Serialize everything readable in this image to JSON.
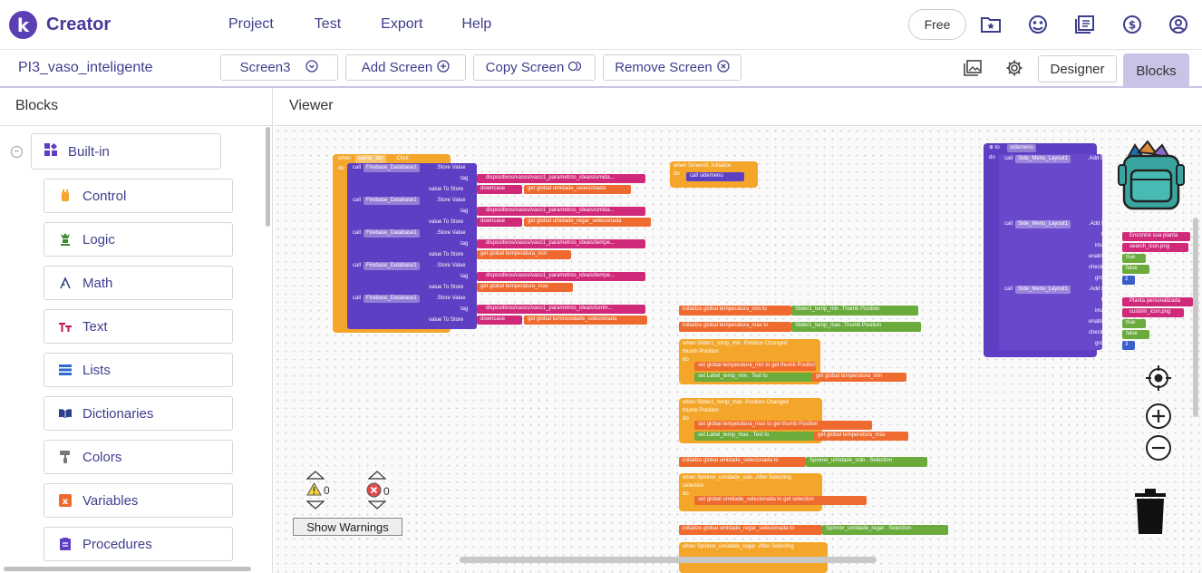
{
  "app": {
    "logo_letter": "k",
    "logo_text": "Creator"
  },
  "menu": [
    "Project",
    "Test",
    "Export",
    "Help"
  ],
  "top_right": {
    "free_label": "Free"
  },
  "toolbar": {
    "project_name": "PI3_vaso_inteligente",
    "screen_label": "Screen3",
    "add_screen": "Add Screen",
    "copy_screen": "Copy Screen",
    "remove_screen": "Remove Screen",
    "designer": "Designer",
    "blocks": "Blocks"
  },
  "left_panel": {
    "title": "Blocks",
    "builtin": "Built-in",
    "categories": [
      "Control",
      "Logic",
      "Math",
      "Text",
      "Lists",
      "Dictionaries",
      "Colors",
      "Variables",
      "Procedures"
    ]
  },
  "viewer": {
    "title": "Viewer",
    "warnings_count": "0",
    "errors_count": "0",
    "show_warnings": "Show Warnings"
  },
  "blocks": {
    "salvar_when": "when",
    "salvar_btn": "salvar_btn",
    "salvar_click": ".Click",
    "do": "do",
    "call": "call",
    "firebase": "Firebase_Database1",
    "store_value": ".Store Value",
    "tag": "tag",
    "value_to_store": "value To Store",
    "path1": "dispositivos/vasos/vaso1_parametros_ideais/umida...",
    "path3": "dispositivos/vasos/vaso1_parametros_ideais/tempe...",
    "path5": "dispositivos/vasos/vaso1_parametros_ideais/lumin...",
    "downcase": "downcase",
    "get": "get",
    "g_umid_sel": "global umidade_selecionada",
    "g_umid_reg": "global umidade_regar_selecionada",
    "g_temp_min": "global temperatura_min",
    "g_temp_max": "global temperatura_max",
    "g_lum_sel": "global luminosidade_selecionada",
    "screen3": "Screen3",
    "initialize": ".Initialize",
    "sidemenu": "sidemenu",
    "init_global": "initialize global",
    "to": "to",
    "temperatura_min": "temperatura_min",
    "temperatura_max": "temperatura_max",
    "slider1_min": "Slider1_temp_min",
    "slider1_max": "Slider1_temp_max",
    "thumb_position": ".Thumb Position",
    "position_changed": ".Position Changed",
    "thumb_pos_param": "thumb Position",
    "set": "set",
    "label_min": "Label_temp_min",
    "label_max": "Label_temp_max",
    "text_prop": ". Text",
    "umidade_selecionada": "umidade_selecionada",
    "spinner_solo": "Spinner_umidade_solo",
    "selection": ". Selection",
    "after_selecting": ".After Selecting",
    "selection_param": "selection",
    "umidade_regar": "umidade_regar_selecionada",
    "spinner_regar": "Spinner_umidade_regar",
    "to_sidemenu": "to",
    "sidemenu_proc": "sidemenu",
    "side_menu_layout": "Side_Menu_Layout1",
    "add_item": ".Add Item",
    "title": "title",
    "image": "image",
    "enabled": "enabled",
    "checked": "checked",
    "group": "group",
    "encontre": "Encontre sua planta",
    "search_icon": "search_icon.png",
    "planta_pers": "Planta personalizada",
    "custom_icon": "custom_icon.png",
    "true_v": "true",
    "false_v": "false",
    "g2": "2",
    "g3": "3"
  }
}
